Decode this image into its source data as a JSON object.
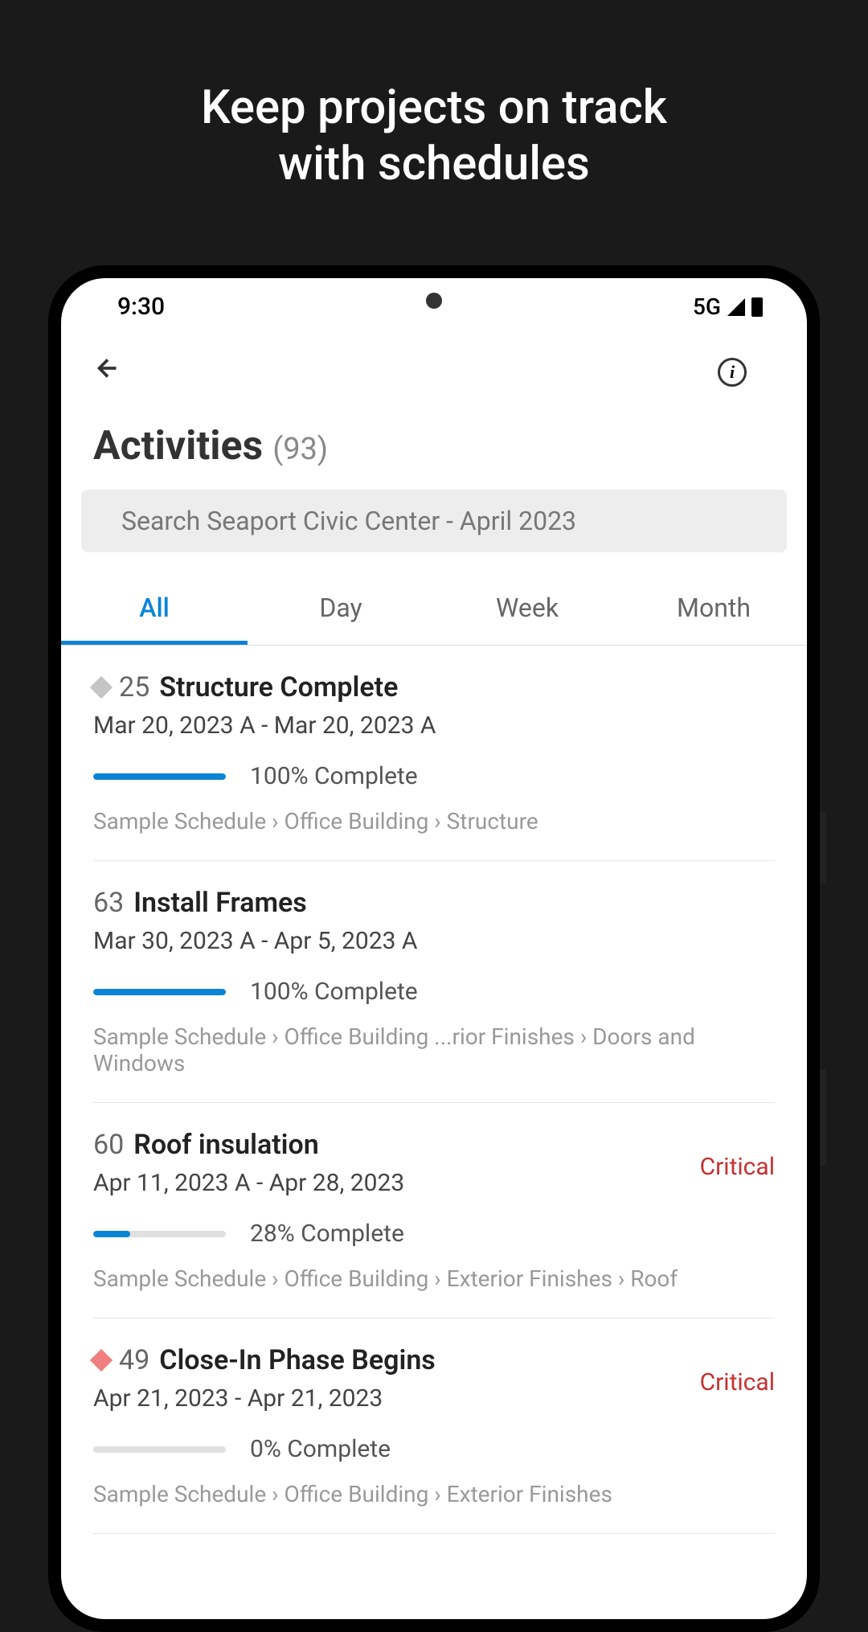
{
  "promo": {
    "line1": "Keep projects on track",
    "line2": "with schedules"
  },
  "statusBar": {
    "time": "9:30",
    "network": "5G"
  },
  "page": {
    "title": "Activities",
    "count": "(93)"
  },
  "search": {
    "placeholder": "Search Seaport Civic Center - April 2023"
  },
  "tabs": {
    "all": "All",
    "day": "Day",
    "week": "Week",
    "month": "Month"
  },
  "activities": [
    {
      "num": "25",
      "name": "Structure Complete",
      "dates": "Mar 20, 2023 A - Mar 20, 2023 A",
      "progressPct": 100,
      "progressText": "100% Complete",
      "breadcrumb": "Sample Schedule › Office Building › Structure",
      "hasDiamond": true,
      "diamondColor": "gray",
      "critical": false
    },
    {
      "num": "63",
      "name": "Install Frames",
      "dates": "Mar 30, 2023 A - Apr 5, 2023 A",
      "progressPct": 100,
      "progressText": "100% Complete",
      "breadcrumb": "Sample Schedule › Office Building ...rior Finishes › Doors and Windows",
      "hasDiamond": false,
      "critical": false
    },
    {
      "num": "60",
      "name": "Roof insulation",
      "dates": "Apr 11, 2023 A - Apr 28, 2023",
      "progressPct": 28,
      "progressText": "28% Complete",
      "breadcrumb": "Sample Schedule › Office Building › Exterior Finishes › Roof",
      "hasDiamond": false,
      "critical": true,
      "criticalLabel": "Critical"
    },
    {
      "num": "49",
      "name": "Close-In Phase Begins",
      "dates": "Apr 21, 2023 - Apr 21, 2023",
      "progressPct": 0,
      "progressText": "0% Complete",
      "breadcrumb": "Sample Schedule › Office Building › Exterior Finishes",
      "hasDiamond": true,
      "diamondColor": "pink",
      "critical": true,
      "criticalLabel": "Critical"
    }
  ]
}
